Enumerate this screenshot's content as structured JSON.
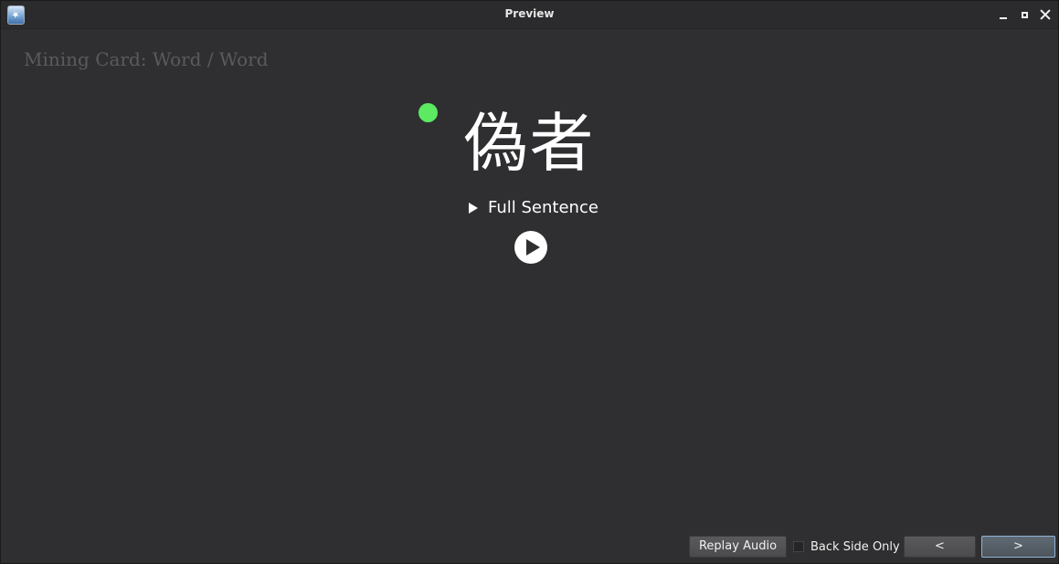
{
  "window": {
    "title": "Preview"
  },
  "card": {
    "template_label": "Mining Card: Word / Word",
    "word": "偽者",
    "sentence_toggle_label": "Full Sentence",
    "status_dot_color": "#5bea62"
  },
  "controls": {
    "replay_audio_label": "Replay Audio",
    "back_side_only_label": "Back Side Only",
    "back_side_only_checked": false,
    "prev_label": "<",
    "next_label": ">"
  },
  "icons": {
    "app": "anki-star-icon",
    "minimize": "minimize-icon",
    "maximize": "maximize-icon",
    "close": "close-icon",
    "disclosure": "triangle-right-icon",
    "audio": "play-circle-icon"
  }
}
